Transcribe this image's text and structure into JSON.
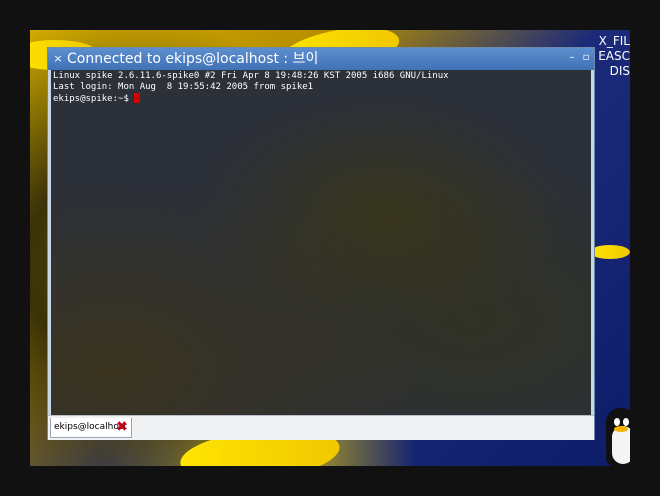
{
  "window": {
    "title": "Connected to ekips@localhost : 브이",
    "close_glyph": "×",
    "minimize_glyph": "–",
    "maximize_glyph": "▫"
  },
  "terminal": {
    "lines": [
      "Linux spike 2.6.11.6-spike0 #2 Fri Apr 8 19:48:26 KST 2005 i686 GNU/Linux",
      "Last login: Mon Aug  8 19:55:42 2005 from spike1"
    ],
    "prompt": "ekips@spike:~$ ",
    "cursor_color": "#d40000"
  },
  "tabs": [
    {
      "label": "ekips@localhost",
      "close_icon": "close-icon",
      "close_color": "#c4001a"
    }
  ],
  "desktop": {
    "text_lines": [
      "X_FIL",
      "EASC",
      "DIS"
    ]
  },
  "colors": {
    "titlebar": "#4a7fc3",
    "terminal_bg": "#05060e",
    "terminal_fg": "#ffffff"
  }
}
